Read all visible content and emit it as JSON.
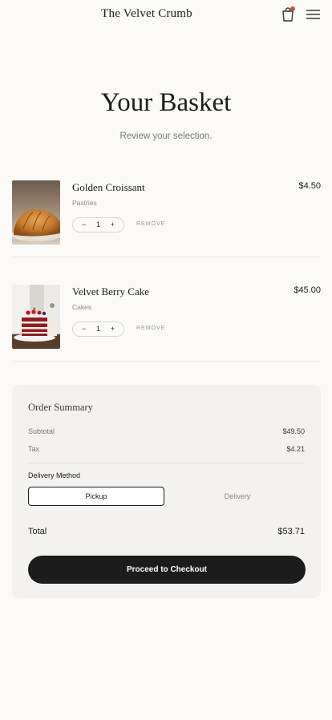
{
  "header": {
    "brand": "The Velvet Crumb",
    "bag_icon": "shopping-bag-icon",
    "menu_icon": "hamburger-menu-icon",
    "notification_color": "#c4573a"
  },
  "page": {
    "title": "Your Basket",
    "subtitle": "Review your selection."
  },
  "items": [
    {
      "name": "Golden Croissant",
      "category": "Pastries",
      "price": "$4.50",
      "quantity": "1",
      "minus": "−",
      "plus": "+",
      "remove_label": "REMOVE"
    },
    {
      "name": "Velvet Berry Cake",
      "category": "Cakes",
      "price": "$45.00",
      "quantity": "1",
      "minus": "−",
      "plus": "+",
      "remove_label": "REMOVE"
    }
  ],
  "summary": {
    "title": "Order Summary",
    "subtotal_label": "Subtotal",
    "subtotal_value": "$49.50",
    "tax_label": "Tax",
    "tax_value": "$4.21",
    "delivery_method_label": "Delivery Method",
    "options": [
      "Pickup",
      "Delivery"
    ],
    "selected_option": "Pickup",
    "total_label": "Total",
    "total_value": "$53.71",
    "checkout_label": "Proceed to Checkout"
  },
  "colors": {
    "background": "#fbfaf7",
    "card": "#f3f2ef",
    "primary_button": "#1c1c1c"
  }
}
